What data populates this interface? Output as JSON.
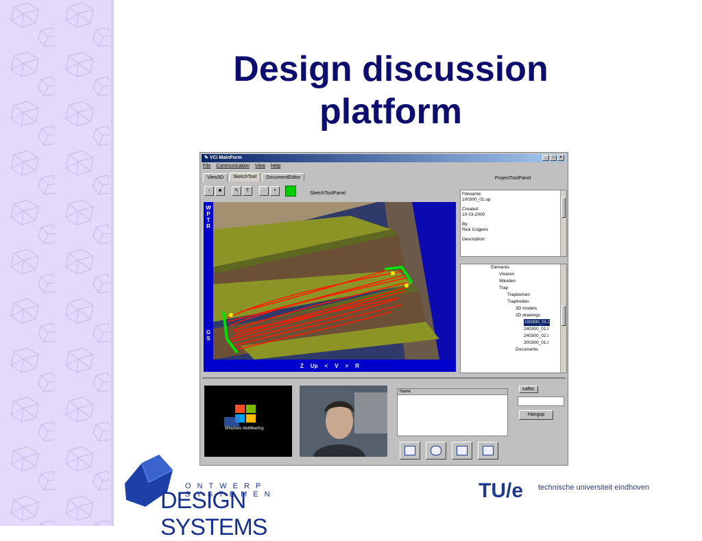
{
  "slide": {
    "title_line1": "Design discussion",
    "title_line2": "platform"
  },
  "app": {
    "window_title": "VCi MainForm",
    "menu": [
      "File",
      "Communication",
      "View",
      "Help"
    ],
    "tabs": [
      "View3D",
      "SketchTool",
      "DocumentEditor"
    ],
    "active_tab": "SketchTool",
    "toolbar_label": "SketchToolPanel",
    "side_letters": [
      "W",
      "P",
      "T",
      "R",
      "G",
      "S"
    ],
    "viewport_controls": [
      "Z",
      "Up",
      "<",
      "V",
      ">",
      "R"
    ],
    "right_panel_title": "ProjectToolPanel",
    "file_info": {
      "filename_label": "Filename:",
      "filename": "100300_01.up",
      "created_label": "Created:",
      "created": "10-03-2000",
      "by_label": "By:",
      "by": "Rick Cuijpers",
      "description_label": "Description:"
    },
    "tree": [
      "Elements",
      "Vloeren",
      "Wanden",
      "Trap",
      "Trapbomen",
      "Traptreden",
      "3D models",
      "2D drawings",
      "100300_01.t",
      "240300_01.t",
      "240300_02.t",
      "300300_01.t",
      "Documents"
    ],
    "tree_selected": "100300_01.t",
    "name_column": "Name",
    "callto_label": "callto:",
    "hangup_label": "Hangup",
    "netmeeting_text1": "Windows",
    "netmeeting_text2": "NetMeeting"
  },
  "logos": {
    "ds_top": "ONTWERP SYSTEMEN",
    "ds_main": "DESIGN SYSTEMS",
    "tue": "TU/e",
    "tue_text": "technische universiteit eindhoven"
  },
  "colors": {
    "title": "#0d0d6e",
    "sidebar": "#e3d9fb",
    "viewport_bg": "#0000cc",
    "sketch_red": "#ff1a00",
    "sketch_green": "#00e000",
    "selection": "#0a246a"
  }
}
